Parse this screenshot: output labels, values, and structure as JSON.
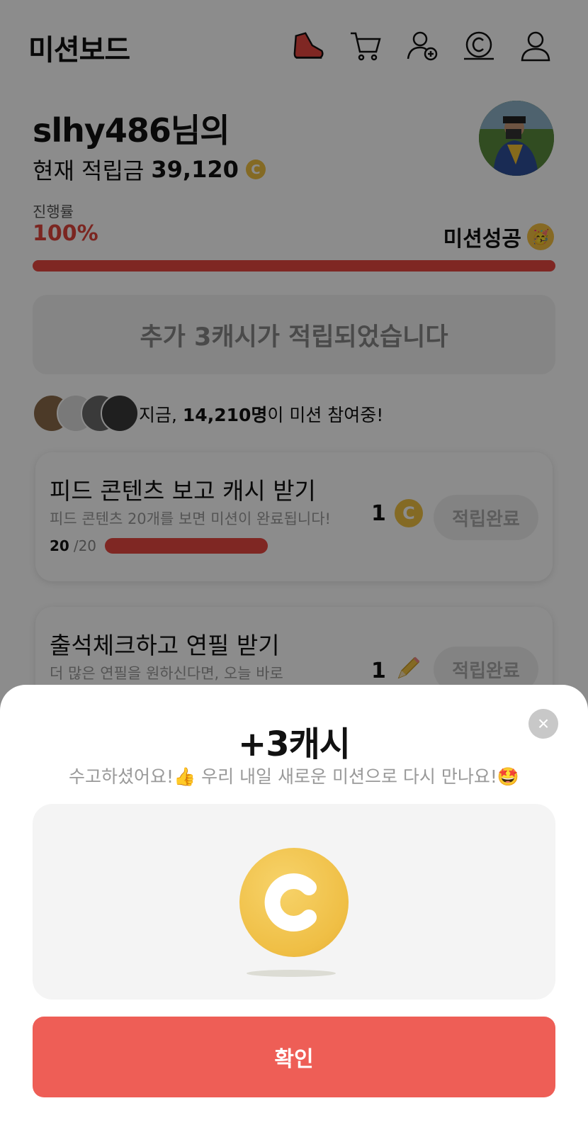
{
  "header": {
    "title": "미션보드",
    "icons": [
      "sneaker-icon",
      "cart-icon",
      "add-friend-icon",
      "cash-coin-icon",
      "profile-icon"
    ]
  },
  "user": {
    "name": "slhy486님의",
    "balance_label": "현재 적립금",
    "balance": "39,120",
    "coin_glyph": "C"
  },
  "progress": {
    "label": "진행률",
    "percent_text": "100%",
    "value": 1.0,
    "status_text": "미션성공",
    "status_emoji": "🥳"
  },
  "notice": "추가 3캐시가 적립되었습니다",
  "participants": {
    "prefix": "지금, ",
    "count": "14,210명",
    "suffix": "이 미션 참여중!"
  },
  "missions": [
    {
      "title": "피드 콘텐츠 보고 캐시 받기",
      "desc": "피드 콘텐츠 20개를 보면 미션이 완료됩니다!",
      "reward_amount": "1",
      "reward_icon": "coin-icon",
      "button": "적립완료",
      "current": "20",
      "total": "/20",
      "ratio": 1.0
    },
    {
      "title": "출석체크하고 연필 받기",
      "desc": "더 많은 연필을 원하신다면, 오늘 바로",
      "reward_amount": "1",
      "reward_icon": "pencil-icon",
      "button": "적립완료"
    }
  ],
  "modal": {
    "title": "+3캐시",
    "subtitle": "수고하셨어요!👍 우리 내일 새로운 미션으로 다시 만나요!🤩",
    "confirm": "확인",
    "close_glyph": "×"
  },
  "colors": {
    "accent": "#e74740",
    "confirm_button": "#ee5e56",
    "coin": "#f0c143"
  }
}
